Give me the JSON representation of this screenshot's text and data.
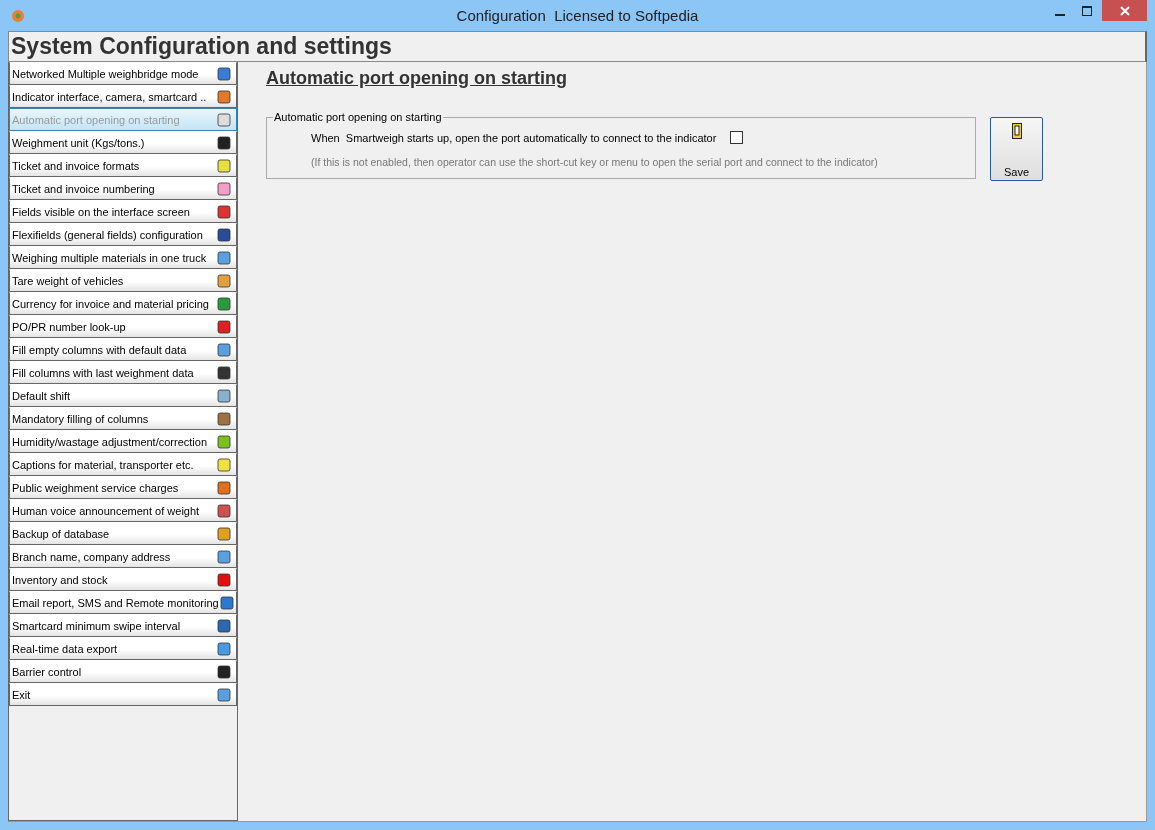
{
  "window": {
    "title": "Configuration  Licensed to Softpedia"
  },
  "header": "System Configuration and settings",
  "sidebar": {
    "items": [
      {
        "label": "Networked Multiple weighbridge mode",
        "selected": false
      },
      {
        "label": "Indicator interface, camera, smartcard ..",
        "selected": false
      },
      {
        "label": "Automatic port opening on starting",
        "selected": true
      },
      {
        "label": "Weighment unit (Kgs/tons.)",
        "selected": false
      },
      {
        "label": "Ticket and invoice formats",
        "selected": false
      },
      {
        "label": "Ticket and invoice numbering",
        "selected": false
      },
      {
        "label": "Fields visible on the interface screen",
        "selected": false
      },
      {
        "label": "Flexifields (general fields) configuration",
        "selected": false
      },
      {
        "label": "Weighing multiple materials in one truck",
        "selected": false
      },
      {
        "label": "Tare weight of vehicles",
        "selected": false
      },
      {
        "label": "Currency for invoice and material pricing",
        "selected": false
      },
      {
        "label": "PO/PR number look-up",
        "selected": false
      },
      {
        "label": "Fill empty columns with default data",
        "selected": false
      },
      {
        "label": "Fill columns with last weighment data",
        "selected": false
      },
      {
        "label": "Default shift",
        "selected": false
      },
      {
        "label": "Mandatory filling of columns",
        "selected": false
      },
      {
        "label": "Humidity/wastage adjustment/correction",
        "selected": false
      },
      {
        "label": "Captions for material, transporter etc.",
        "selected": false
      },
      {
        "label": "Public weighment service charges",
        "selected": false
      },
      {
        "label": "Human voice announcement of weight",
        "selected": false
      },
      {
        "label": "Backup of database",
        "selected": false
      },
      {
        "label": "Branch name, company address",
        "selected": false
      },
      {
        "label": "Inventory and stock",
        "selected": false
      },
      {
        "label": "Email report, SMS and Remote monitoring",
        "selected": false
      },
      {
        "label": "Smartcard minimum swipe interval",
        "selected": false
      },
      {
        "label": "Real-time data export",
        "selected": false
      },
      {
        "label": "Barrier control",
        "selected": false
      },
      {
        "label": "Exit",
        "selected": false
      }
    ]
  },
  "content": {
    "heading": "Automatic port opening on starting",
    "group": {
      "legend": "Automatic port opening on starting",
      "option": {
        "label": "When  Smartweigh starts up, open the port automatically to connect to the indicator",
        "checked": false
      },
      "note": "(If this is not enabled, then operator can use the short-cut key or menu to open the serial port and connect  to the indicator)"
    },
    "save_button": "Save"
  }
}
